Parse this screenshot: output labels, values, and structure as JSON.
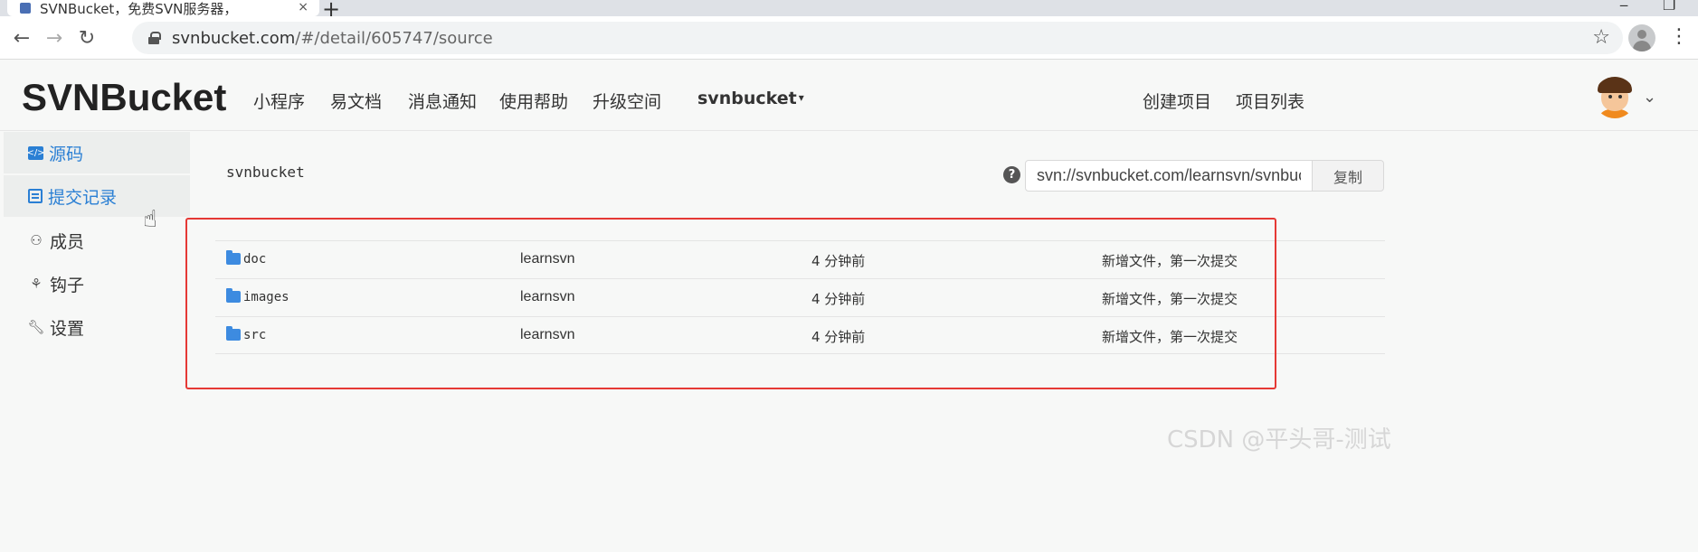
{
  "browser": {
    "tab_title": "SVNBucket，免费SVN服务器，",
    "tab_close": "×",
    "new_tab": "+",
    "minimize": "‒",
    "maximize": "❐",
    "back": "←",
    "forward": "→",
    "reload": "↻",
    "url_host": "svnbucket.com",
    "url_path": "/#/detail/605747/source",
    "star": "☆",
    "menu": "⋮"
  },
  "header": {
    "logo": "SVNBucket",
    "nav": [
      "小程序",
      "易文档",
      "消息通知",
      "使用帮助",
      "升级空间"
    ],
    "user_menu": "svnbucket",
    "user_menu_caret": "▾",
    "right_links": [
      "创建项目",
      "项目列表"
    ],
    "avatar_caret": "⌄"
  },
  "sidebar": {
    "items": [
      {
        "label": "源码",
        "icon": "code-icon"
      },
      {
        "label": "提交记录",
        "icon": "commit-list-icon"
      },
      {
        "label": "成员",
        "icon": "members-icon"
      },
      {
        "label": "钩子",
        "icon": "hook-icon"
      },
      {
        "label": "设置",
        "icon": "wrench-icon"
      }
    ]
  },
  "main": {
    "repo_name": "svnbucket",
    "help": "?",
    "svn_url": "svn://svnbucket.com/learnsvn/svnbucke",
    "copy_label": "复制",
    "files": [
      {
        "name": "doc",
        "author": "learnsvn",
        "time": "4 分钟前",
        "message": "新增文件，第一次提交"
      },
      {
        "name": "images",
        "author": "learnsvn",
        "time": "4 分钟前",
        "message": "新增文件，第一次提交"
      },
      {
        "name": "src",
        "author": "learnsvn",
        "time": "4 分钟前",
        "message": "新增文件，第一次提交"
      }
    ]
  },
  "watermark": "CSDN @平头哥-测试",
  "colors": {
    "accent": "#2a7fd4",
    "highlight": "#e53935",
    "folder": "#3d8be0"
  }
}
